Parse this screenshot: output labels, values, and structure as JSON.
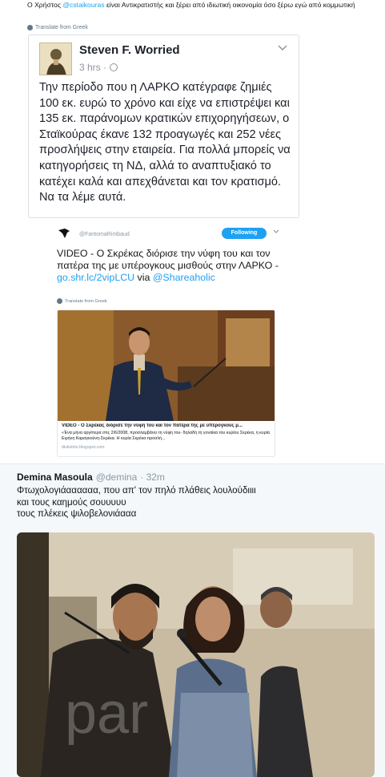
{
  "top_tweet": {
    "text_before_mention": "Ο Χρήστος ",
    "mention": "@cstaikouras",
    "text_after_mention": " είναι Αντικρατιστής και ξέρει από ιδιωτική οικονομία όσο ξέρω εγώ από κομμωτική",
    "translate": "Translate from Greek"
  },
  "fb_post": {
    "author": "Steven F. Worried",
    "time": "3 hrs ·",
    "body": "Την περίοδο που η ΛΑΡΚΟ κατέγραφε ζημιές 100 εκ. ευρώ το χρόνο και είχε να επιστρέψει και 135 εκ. παράνομων κρατικών επιχορηγήσεων, ο Σταϊκούρας έκανε 132 προαγωγές και 252 νέες προσλήψεις στην εταιρεία. Για πολλά μπορείς να κατηγορήσεις τη ΝΔ, αλλά το αναπτυξιακό το κατέχει καλά και απεχθάνεται και τον κρατισμό. Να τα λέμε αυτά."
  },
  "embedded_tweet": {
    "handle": "@FantomaRimbaud",
    "follow_label": "Following",
    "text": "VIDEO - Ο Σκρέκας διόρισε την νύφη του και τον πατέρα της με υπέρογκους μισθούς στην ΛΑΡΚΟ - ",
    "link": "go.shr.lc/2vipLCU",
    "via": " via ",
    "via_handle": "@Shareaholic",
    "translate": "Translate from Greek",
    "card": {
      "title": "VIDEO - Ο Σκρέκας διόρισε την νύφη του και τον πατέρα της με υπέρογκους μ...",
      "description": "«Ένα μήνα αργότερα στις 2/6/2008, προσλαμβάνει τη νύφη του- δηλαδή τη γυναίκα του κυρίου Σκρέκα, η κυρία Ειρήνη Καραγκούνη-Σκρέκα. Η κυρία Σκρέκα προσλή...",
      "domain": "diulistirio.blogspot.com"
    }
  },
  "tweet2": {
    "name": "Demina Masoula",
    "handle": "@demina",
    "time": "· 32m",
    "lines": [
      "Φτωχολογιάαααααα, που απ' τον πηλό πλάθεις λουλούδιιιι",
      "και τους καημούς σουυυυυ",
      "τους πλέκεις ψιλοβελονιάααα"
    ],
    "photo_watermark": "par"
  },
  "colors": {
    "twitter_blue": "#1da1f2",
    "fb_text": "#1d2129",
    "muted": "#8899a6"
  }
}
